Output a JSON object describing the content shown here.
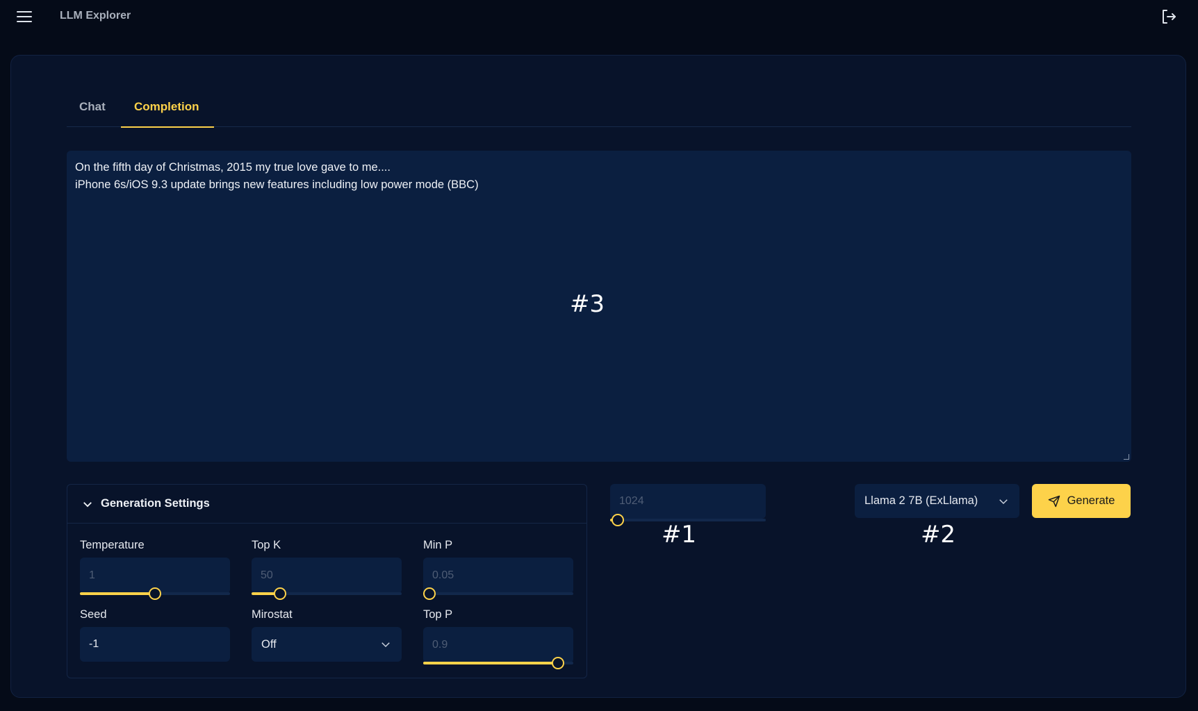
{
  "app": {
    "title": "LLM Explorer"
  },
  "tabs": [
    {
      "label": "Chat"
    },
    {
      "label": "Completion"
    }
  ],
  "prompt": {
    "value": "On the fifth day of Christmas, 2015 my true love gave to me....\niPhone 6s/iOS 9.3 update brings new features including low power mode (BBC)"
  },
  "annotations": [
    "#1",
    "#2",
    "#3"
  ],
  "settings": {
    "title": "Generation Settings",
    "temperature": {
      "label": "Temperature",
      "value": "1",
      "fraction": 0.5
    },
    "top_k": {
      "label": "Top K",
      "value": "50",
      "fraction": 0.19
    },
    "min_p": {
      "label": "Min P",
      "value": "0.05",
      "fraction": 0.04
    },
    "seed": {
      "label": "Seed",
      "value": "-1"
    },
    "mirostat": {
      "label": "Mirostat",
      "value": "Off"
    },
    "top_p": {
      "label": "Top P",
      "value": "0.9",
      "fraction": 0.9
    }
  },
  "max_tokens": {
    "value": "1024",
    "fraction": 0.05
  },
  "model": {
    "value": "Llama 2 7B (ExLlama)"
  },
  "generate": {
    "label": "Generate"
  },
  "colors": {
    "accent": "#fdd24a",
    "bg": "#050b18",
    "card": "#08132a",
    "input": "#0b1f40"
  }
}
